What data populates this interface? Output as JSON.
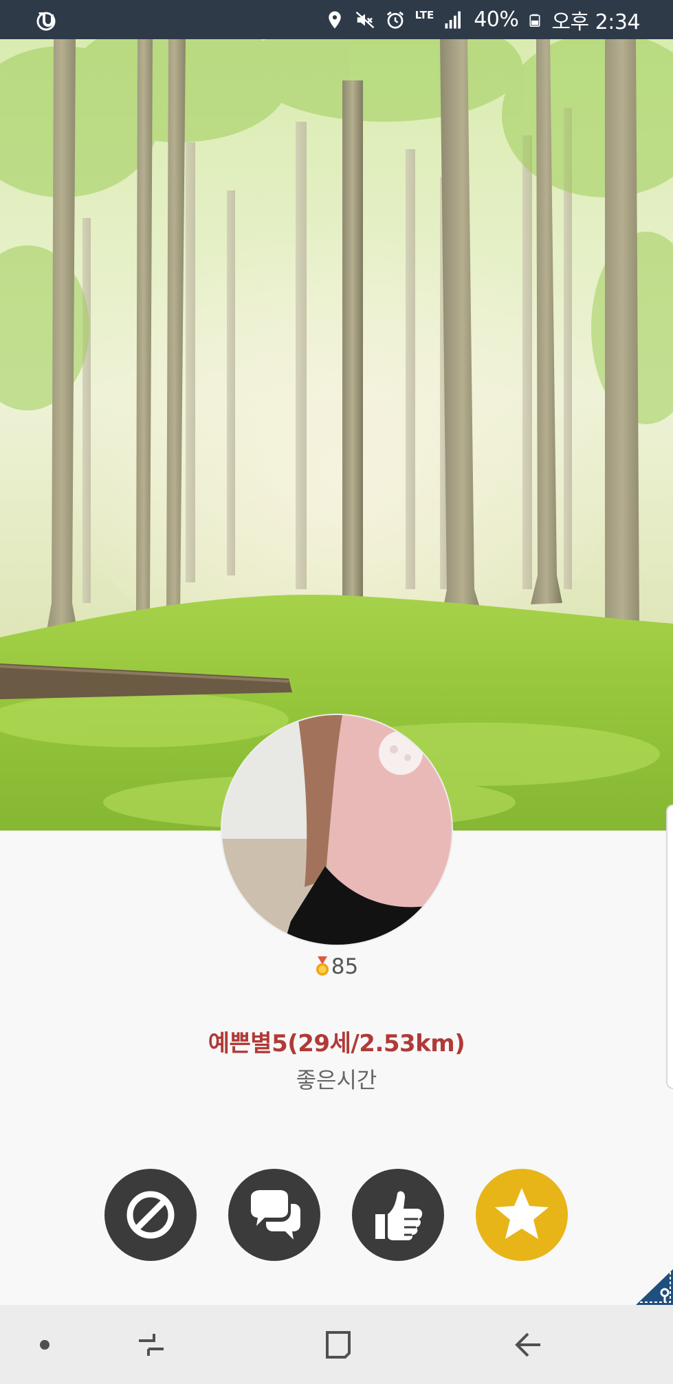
{
  "status_bar": {
    "carrier_icon": "uplus-logo-icon",
    "icons": [
      "location-icon",
      "mute-icon",
      "alarm-icon",
      "lte-icon",
      "signal-icon",
      "battery-icon"
    ],
    "network": "LTE",
    "battery": "40%",
    "time": "오후 2:34"
  },
  "hero": {
    "image": "misty-forest-background"
  },
  "profile": {
    "avatar": "profile-photo",
    "score_icon": "medal-icon",
    "score": "85",
    "name_line": "예쁜별5(29세/2.53km)",
    "status_message": "좋은시간"
  },
  "actions": [
    {
      "name": "block",
      "icon": "block-icon"
    },
    {
      "name": "chat",
      "icon": "chat-bubbles-icon"
    },
    {
      "name": "like",
      "icon": "thumbs-up-icon"
    },
    {
      "name": "favorite",
      "icon": "star-icon"
    }
  ],
  "colors": {
    "status_bar": "#2e3a48",
    "name": "#b03a38",
    "action_button": "#3b3b3b",
    "favorite_button": "#e8b518",
    "nav_bar": "#ececec"
  },
  "nav_bar": {
    "items": [
      "dot-icon",
      "recent-apps-icon",
      "home-icon",
      "back-icon"
    ]
  }
}
